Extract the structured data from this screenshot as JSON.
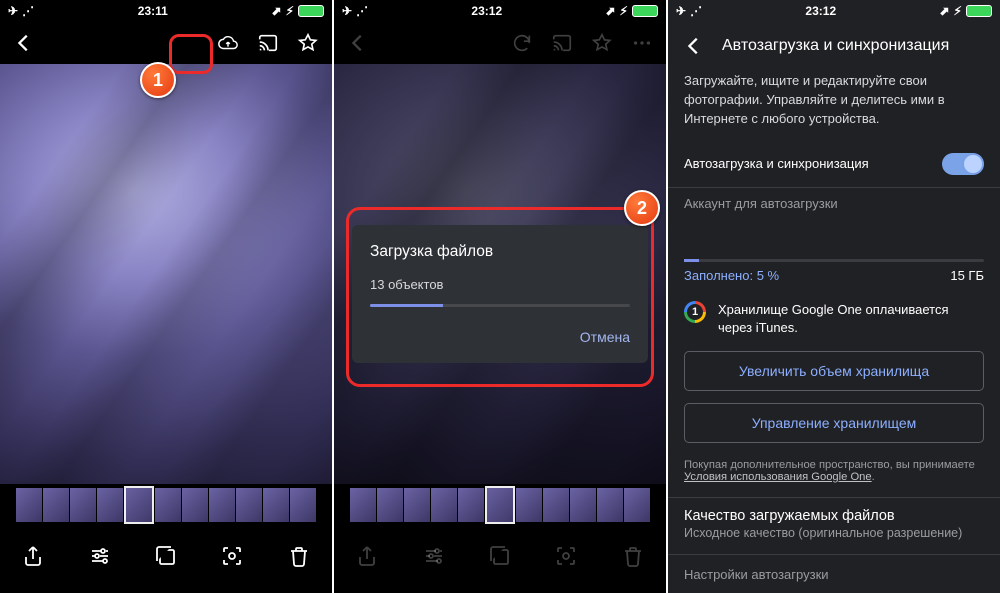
{
  "panel1": {
    "status_time": "23:11",
    "icons": {
      "back": "back",
      "cloud": "cloud-upload",
      "cast": "cast",
      "star": "star"
    },
    "bottom": [
      "share",
      "tune",
      "library",
      "lens",
      "trash"
    ]
  },
  "panel2": {
    "status_time": "23:12",
    "dialog": {
      "title": "Загрузка файлов",
      "count": "13 объектов",
      "cancel": "Отмена"
    }
  },
  "panel3": {
    "status_time": "23:12",
    "title": "Автозагрузка и синхронизация",
    "desc": "Загружайте, ищите и редактируйте свои фотографии. Управляйте и делитесь ими в Интернете с любого устройства.",
    "toggle_label": "Автозагрузка и синхронизация",
    "account_label": "Аккаунт для автозагрузки",
    "storage_filled": "Заполнено: 5 %",
    "storage_total": "15 ГБ",
    "g1_text": "Хранилище Google One оплачивается через iTunes.",
    "g1_num": "1",
    "btn_increase": "Увеличить объем хранилища",
    "btn_manage": "Управление хранилищем",
    "fine_prefix": "Покупая дополнительное пространство, вы принимаете ",
    "fine_link": "Условия использования Google One",
    "quality_title": "Качество загружаемых файлов",
    "quality_sub": "Исходное качество (оригинальное разрешение)",
    "autoload_settings": "Настройки автозагрузки"
  }
}
